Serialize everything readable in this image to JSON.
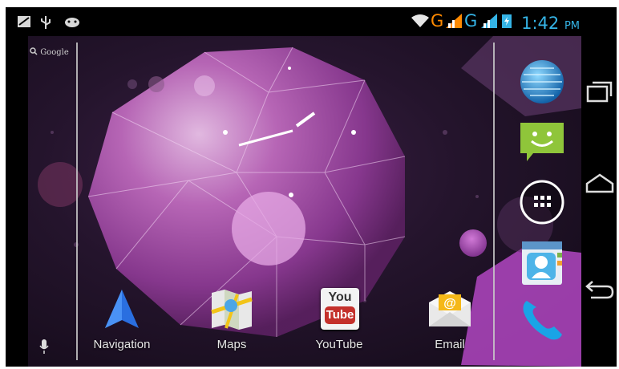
{
  "status_bar": {
    "network_1": "G",
    "network_2": "G",
    "time": "1:42",
    "ampm": "PM",
    "left_icons": [
      "notification-icon",
      "usb-icon",
      "android-debug-icon"
    ],
    "right_icons": [
      "wifi-icon",
      "signal-icon",
      "signal-icon",
      "battery-icon"
    ]
  },
  "search": {
    "label": "Google"
  },
  "apps": [
    {
      "label": "Navigation",
      "icon": "navigation-icon"
    },
    {
      "label": "Maps",
      "icon": "maps-icon"
    },
    {
      "label": "YouTube",
      "icon": "youtube-icon"
    },
    {
      "label": "Email",
      "icon": "email-icon"
    }
  ],
  "youtube_text": {
    "you": "You",
    "tube": "Tube"
  },
  "dock": [
    "browser-globe-icon",
    "messaging-icon",
    "all-apps-icon",
    "contacts-icon",
    "phone-icon"
  ],
  "nav_buttons": [
    "recent-apps-button",
    "home-button",
    "back-button"
  ],
  "colors": {
    "clock_blue": "#35b4e6",
    "network_orange": "#ff8a00"
  }
}
